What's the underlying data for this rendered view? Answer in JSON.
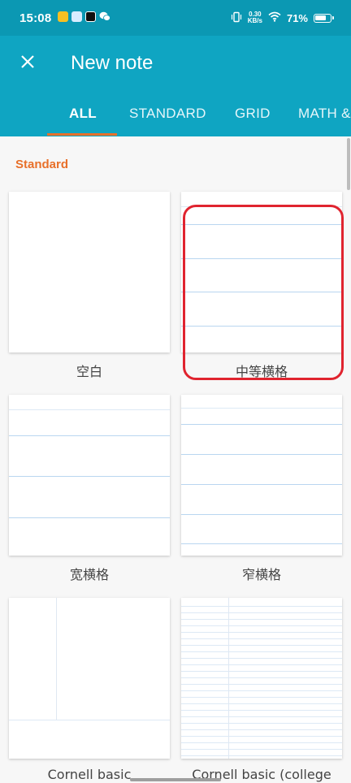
{
  "status_bar": {
    "time": "15:08",
    "net_speed_value": "0.30",
    "net_speed_unit": "KB/s",
    "battery": "71%"
  },
  "app_bar": {
    "title": "New note",
    "tabs": [
      {
        "label": "ALL"
      },
      {
        "label": "STANDARD"
      },
      {
        "label": "GRID"
      },
      {
        "label": "MATH &"
      }
    ]
  },
  "section": {
    "title": "Standard"
  },
  "templates": [
    {
      "label": "空白"
    },
    {
      "label": "中等横格"
    },
    {
      "label": "宽横格"
    },
    {
      "label": "窄横格"
    },
    {
      "label": "Cornell basic"
    },
    {
      "label": "Cornell basic (college"
    }
  ],
  "colors": {
    "primary": "#0fa5c2",
    "status_bar": "#0b98b3",
    "accent": "#e8702a",
    "highlight": "#e0242f",
    "rule_line": "#b9d6f0"
  }
}
